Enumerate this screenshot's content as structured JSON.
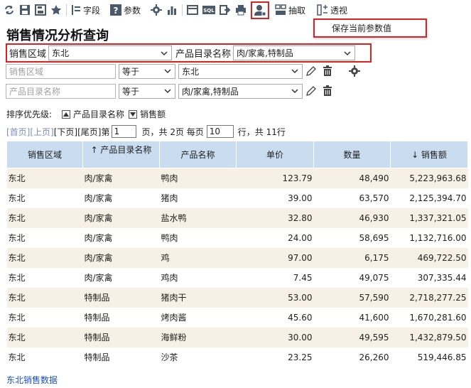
{
  "toolbar": {
    "fields_label": "字段",
    "params_label": "参数",
    "extract_label": "抽取",
    "pivot_label": "透视"
  },
  "user_menu": {
    "save_params": "保存当前参数值"
  },
  "title": "销售情况分析查询",
  "params": {
    "region_label": "销售区域",
    "region_value": "东北",
    "catalog_label": "产品目录名称",
    "catalog_value": "肉/家禽,特制品"
  },
  "filters": [
    {
      "field_placeholder": "销售区域",
      "operator": "等于",
      "value": "东北"
    },
    {
      "field_placeholder": "产品目录名称",
      "operator": "等于",
      "value": "肉/家禽,特制品"
    }
  ],
  "sort": {
    "label": "排序优先级:",
    "items": [
      {
        "label": "产品目录名称",
        "dir": "asc"
      },
      {
        "label": "销售额",
        "dir": "desc"
      }
    ]
  },
  "pager": {
    "first": "[首页]",
    "prev": "[上页]",
    "next": "[下页]",
    "last": "[尾页]",
    "page_prefix": "第",
    "page": "1",
    "page_mid": "页，共 2页 每页",
    "per_page": "10",
    "page_suffix": "行，共 11行"
  },
  "table": {
    "headers": [
      "销售区域",
      "↑ 产品目录名称",
      "产品名称",
      "单价",
      "数量",
      "↓ 销售额"
    ],
    "rows": [
      [
        "东北",
        "肉/家禽",
        "鸭肉",
        "123.79",
        "48,490",
        "5,223,963.68"
      ],
      [
        "东北",
        "肉/家禽",
        "猪肉",
        "39.00",
        "63,570",
        "2,125,394.70"
      ],
      [
        "东北",
        "肉/家禽",
        "盐水鸭",
        "32.80",
        "46,930",
        "1,337,321.05"
      ],
      [
        "东北",
        "肉/家禽",
        "鸭肉",
        "24.00",
        "58,695",
        "1,132,716.00"
      ],
      [
        "东北",
        "肉/家禽",
        "鸡",
        "97.00",
        "6,175",
        "469,722.50"
      ],
      [
        "东北",
        "肉/家禽",
        "鸡肉",
        "7.45",
        "49,075",
        "307,335.44"
      ],
      [
        "东北",
        "特制品",
        "猪肉干",
        "53.00",
        "57,590",
        "2,718,277.25"
      ],
      [
        "东北",
        "特制品",
        "烤肉酱",
        "45.60",
        "41,600",
        "1,670,281.60"
      ],
      [
        "东北",
        "特制品",
        "海鲜粉",
        "30.00",
        "49,595",
        "1,432,879.50"
      ],
      [
        "东北",
        "特制品",
        "沙茶",
        "23.25",
        "26,260",
        "519,446.85"
      ]
    ]
  },
  "footer_link": "东北销售数据",
  "colors": {
    "header_bg": "#c9dcf0",
    "odd_row_bg": "#f6f1e4",
    "highlight": "#e02020",
    "link": "#1a4fcf"
  }
}
